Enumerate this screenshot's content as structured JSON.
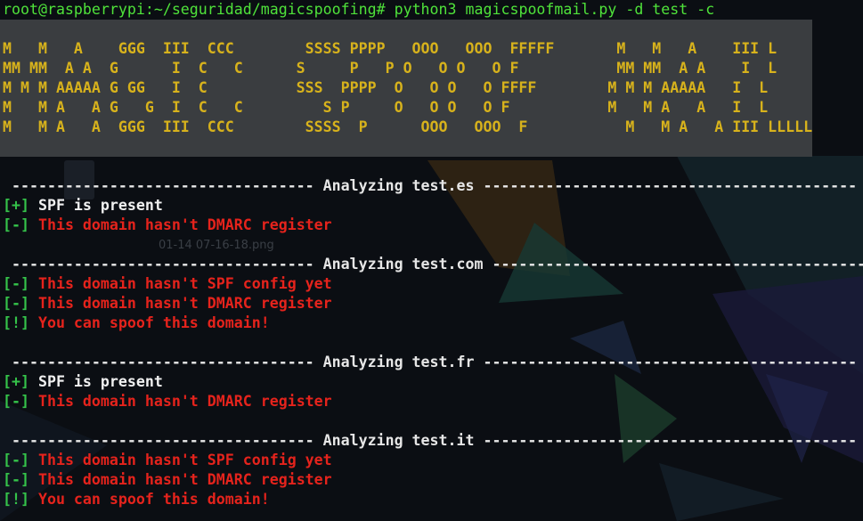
{
  "terminal": {
    "prompt": "root@raspberrypi:~/seguridad/magicspoofing#",
    "command": " python3 magicspoofmail.py -d test -c"
  },
  "banner": [
    "M   M   A    GGG  III  CCC        SSSS PPPP   OOO   OOO  FFFFF       M   M   A    III L",
    "MM MM  A A  G      I  C   C      S     P   P O   O O   O F           MM MM  A A    I  L",
    "M M M AAAAA G GG   I  C          SSS  PPPP  O   O O   O FFFF        M M M AAAAA   I  L",
    "M   M A   A G   G  I  C   C         S P     O   O O   O F           M   M A   A   I  L",
    "M   M A   A  GGG  III  CCC        SSSS  P      OOO   OOO  F           M   M A   A III LLLLL"
  ],
  "sections": [
    {
      "header": " ---------------------------------- Analyzing test.es ------------------------------------------",
      "lines": [
        {
          "tag": "[+]",
          "text": " SPF is present",
          "style": "ok"
        },
        {
          "tag": "[-]",
          "text": " This domain hasn't DMARC register",
          "style": "bad"
        }
      ]
    },
    {
      "header": " ---------------------------------- Analyzing test.com ------------------------------------------",
      "lines": [
        {
          "tag": "[-]",
          "text": " This domain hasn't SPF config yet",
          "style": "bad"
        },
        {
          "tag": "[-]",
          "text": " This domain hasn't DMARC register",
          "style": "bad"
        },
        {
          "tag": "[!]",
          "text": " You can spoof this domain!",
          "style": "bad"
        }
      ]
    },
    {
      "header": " ---------------------------------- Analyzing test.fr ------------------------------------------",
      "lines": [
        {
          "tag": "[+]",
          "text": " SPF is present",
          "style": "ok"
        },
        {
          "tag": "[-]",
          "text": " This domain hasn't DMARC register",
          "style": "bad"
        }
      ]
    },
    {
      "header": " ---------------------------------- Analyzing test.it ------------------------------------------",
      "lines": [
        {
          "tag": "[-]",
          "text": " This domain hasn't SPF config yet",
          "style": "bad"
        },
        {
          "tag": "[-]",
          "text": " This domain hasn't DMARC register",
          "style": "bad"
        },
        {
          "tag": "[!]",
          "text": " You can spoof this domain!",
          "style": "bad"
        }
      ]
    }
  ],
  "ghost": {
    "file_label": "01-14 07-16-18.png"
  },
  "colors": {
    "prompt": "#4fe23a",
    "banner": "#d7b21c",
    "tag": "#35c34a",
    "ok_text": "#f0f0f0",
    "bad_text": "#e5231c",
    "background": "#0b0e13"
  }
}
